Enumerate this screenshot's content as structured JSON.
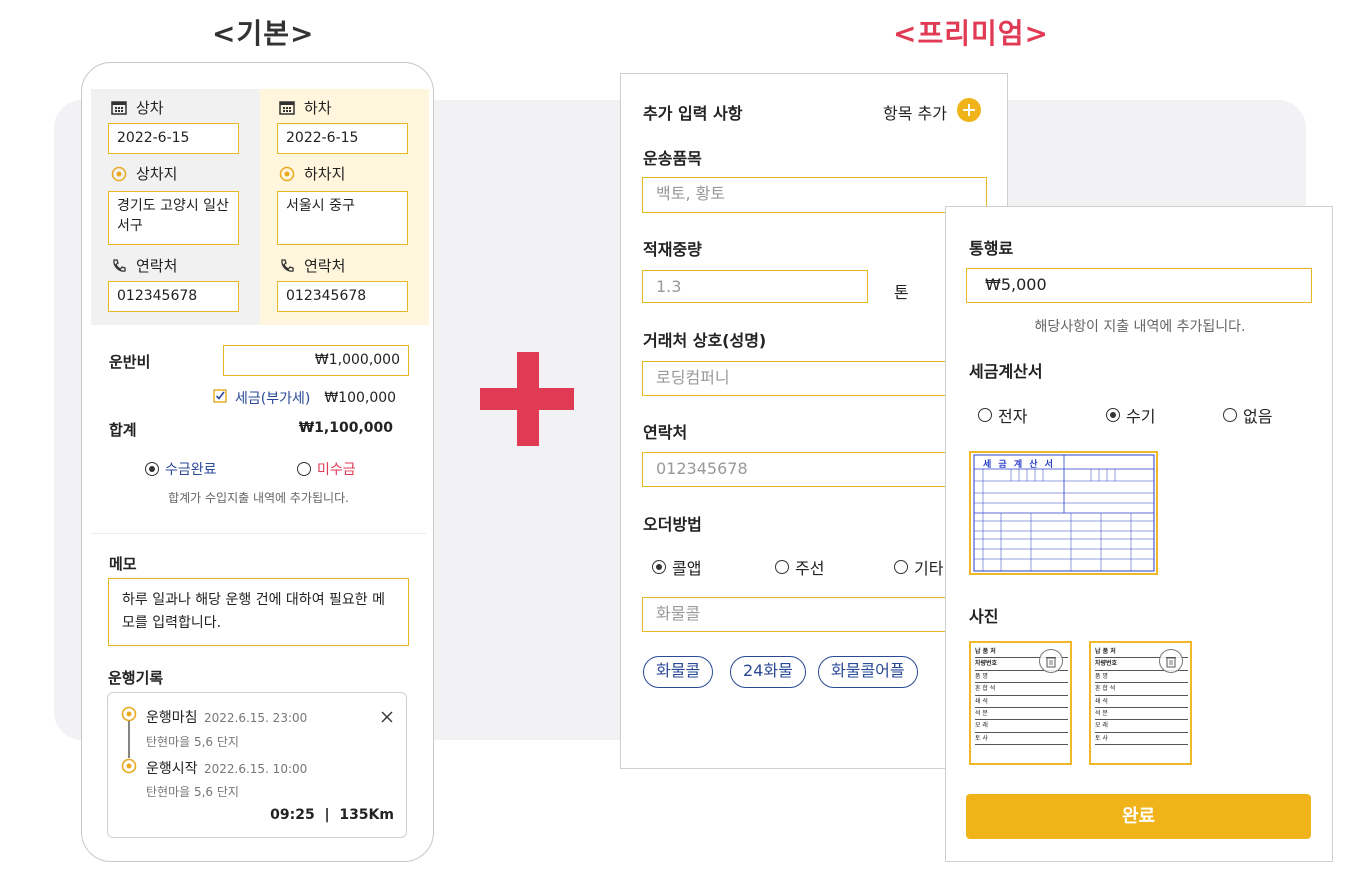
{
  "titles": {
    "basic": "<기본>",
    "premium": "<프리미엄>"
  },
  "phone": {
    "load_label": "상차",
    "unload_label": "하차",
    "load_date": "2022-6-15",
    "unload_date": "2022-6-15",
    "load_place_label": "상차지",
    "unload_place_label": "하차지",
    "load_place": "경기도 고양시 일산서구",
    "unload_place": "서울시 중구",
    "contact_label": "연락처",
    "load_contact": "012345678",
    "unload_contact": "012345678",
    "fare_label": "운반비",
    "fare_value": "₩1,000,000",
    "tax_label": "세금(부가세)",
    "tax_value": "₩100,000",
    "total_label": "합계",
    "total_value": "₩1,100,000",
    "paid_label": "수금완료",
    "unpaid_label": "미수금",
    "total_note": "합계가 수입지출 내역에 추가됩니다.",
    "memo_label": "메모",
    "memo_text": "하루 일과나 해당 운행 건에  대하여 필요한 메모를 입력합니다.",
    "log_label": "운행기록",
    "log": [
      {
        "event": "운행마침",
        "time": "2022.6.15. 23:00",
        "place": "탄현마을 5,6 단지"
      },
      {
        "event": "운행시작",
        "time": "2022.6.15. 10:00",
        "place": "탄현마을 5,6 단지"
      }
    ],
    "log_summary": "09:25  |  135Km"
  },
  "premium_left": {
    "header": "추가 입력 사항",
    "add_item": "항목 추가",
    "cargo_label": "운송품목",
    "cargo_placeholder": "백토, 황토",
    "weight_label": "적재중량",
    "weight_placeholder": "1.3",
    "weight_unit": "톤",
    "client_label": "거래처 상호(성명)",
    "client_placeholder": "로딩컴퍼니",
    "contact_label": "연락처",
    "contact_placeholder": "012345678",
    "order_label": "오더방법",
    "order_options": [
      "콜앱",
      "주선",
      "기타"
    ],
    "order_selected": "콜앱",
    "order_placeholder": "화물콜",
    "chips": [
      "화물콜",
      "24화물",
      "화물콜어플"
    ]
  },
  "premium_right": {
    "toll_label": "통행료",
    "toll_value": "₩5,000",
    "toll_note": "해당사항이 지출 내역에 추가됩니다.",
    "invoice_label": "세금계산서",
    "invoice_options": [
      "전자",
      "수기",
      "없음"
    ],
    "invoice_selected": "수기",
    "invoice_doc_title": "세 금 계 산 서",
    "photo_label": "사진",
    "receipt_rows": [
      "납 품 처",
      "차량번호",
      "품   명",
      "혼 합 석",
      "쇄   석",
      "석   분",
      "모   래",
      "토   사"
    ],
    "done": "완료"
  },
  "colors": {
    "accent": "#f0b41a",
    "brand_red": "#e03a54",
    "link_blue": "#2a4a96"
  },
  "icons": [
    "calendar-icon",
    "location-pin-icon",
    "phone-icon",
    "checkbox-checked-icon",
    "plus-circle-icon",
    "close-icon",
    "trash-icon"
  ]
}
